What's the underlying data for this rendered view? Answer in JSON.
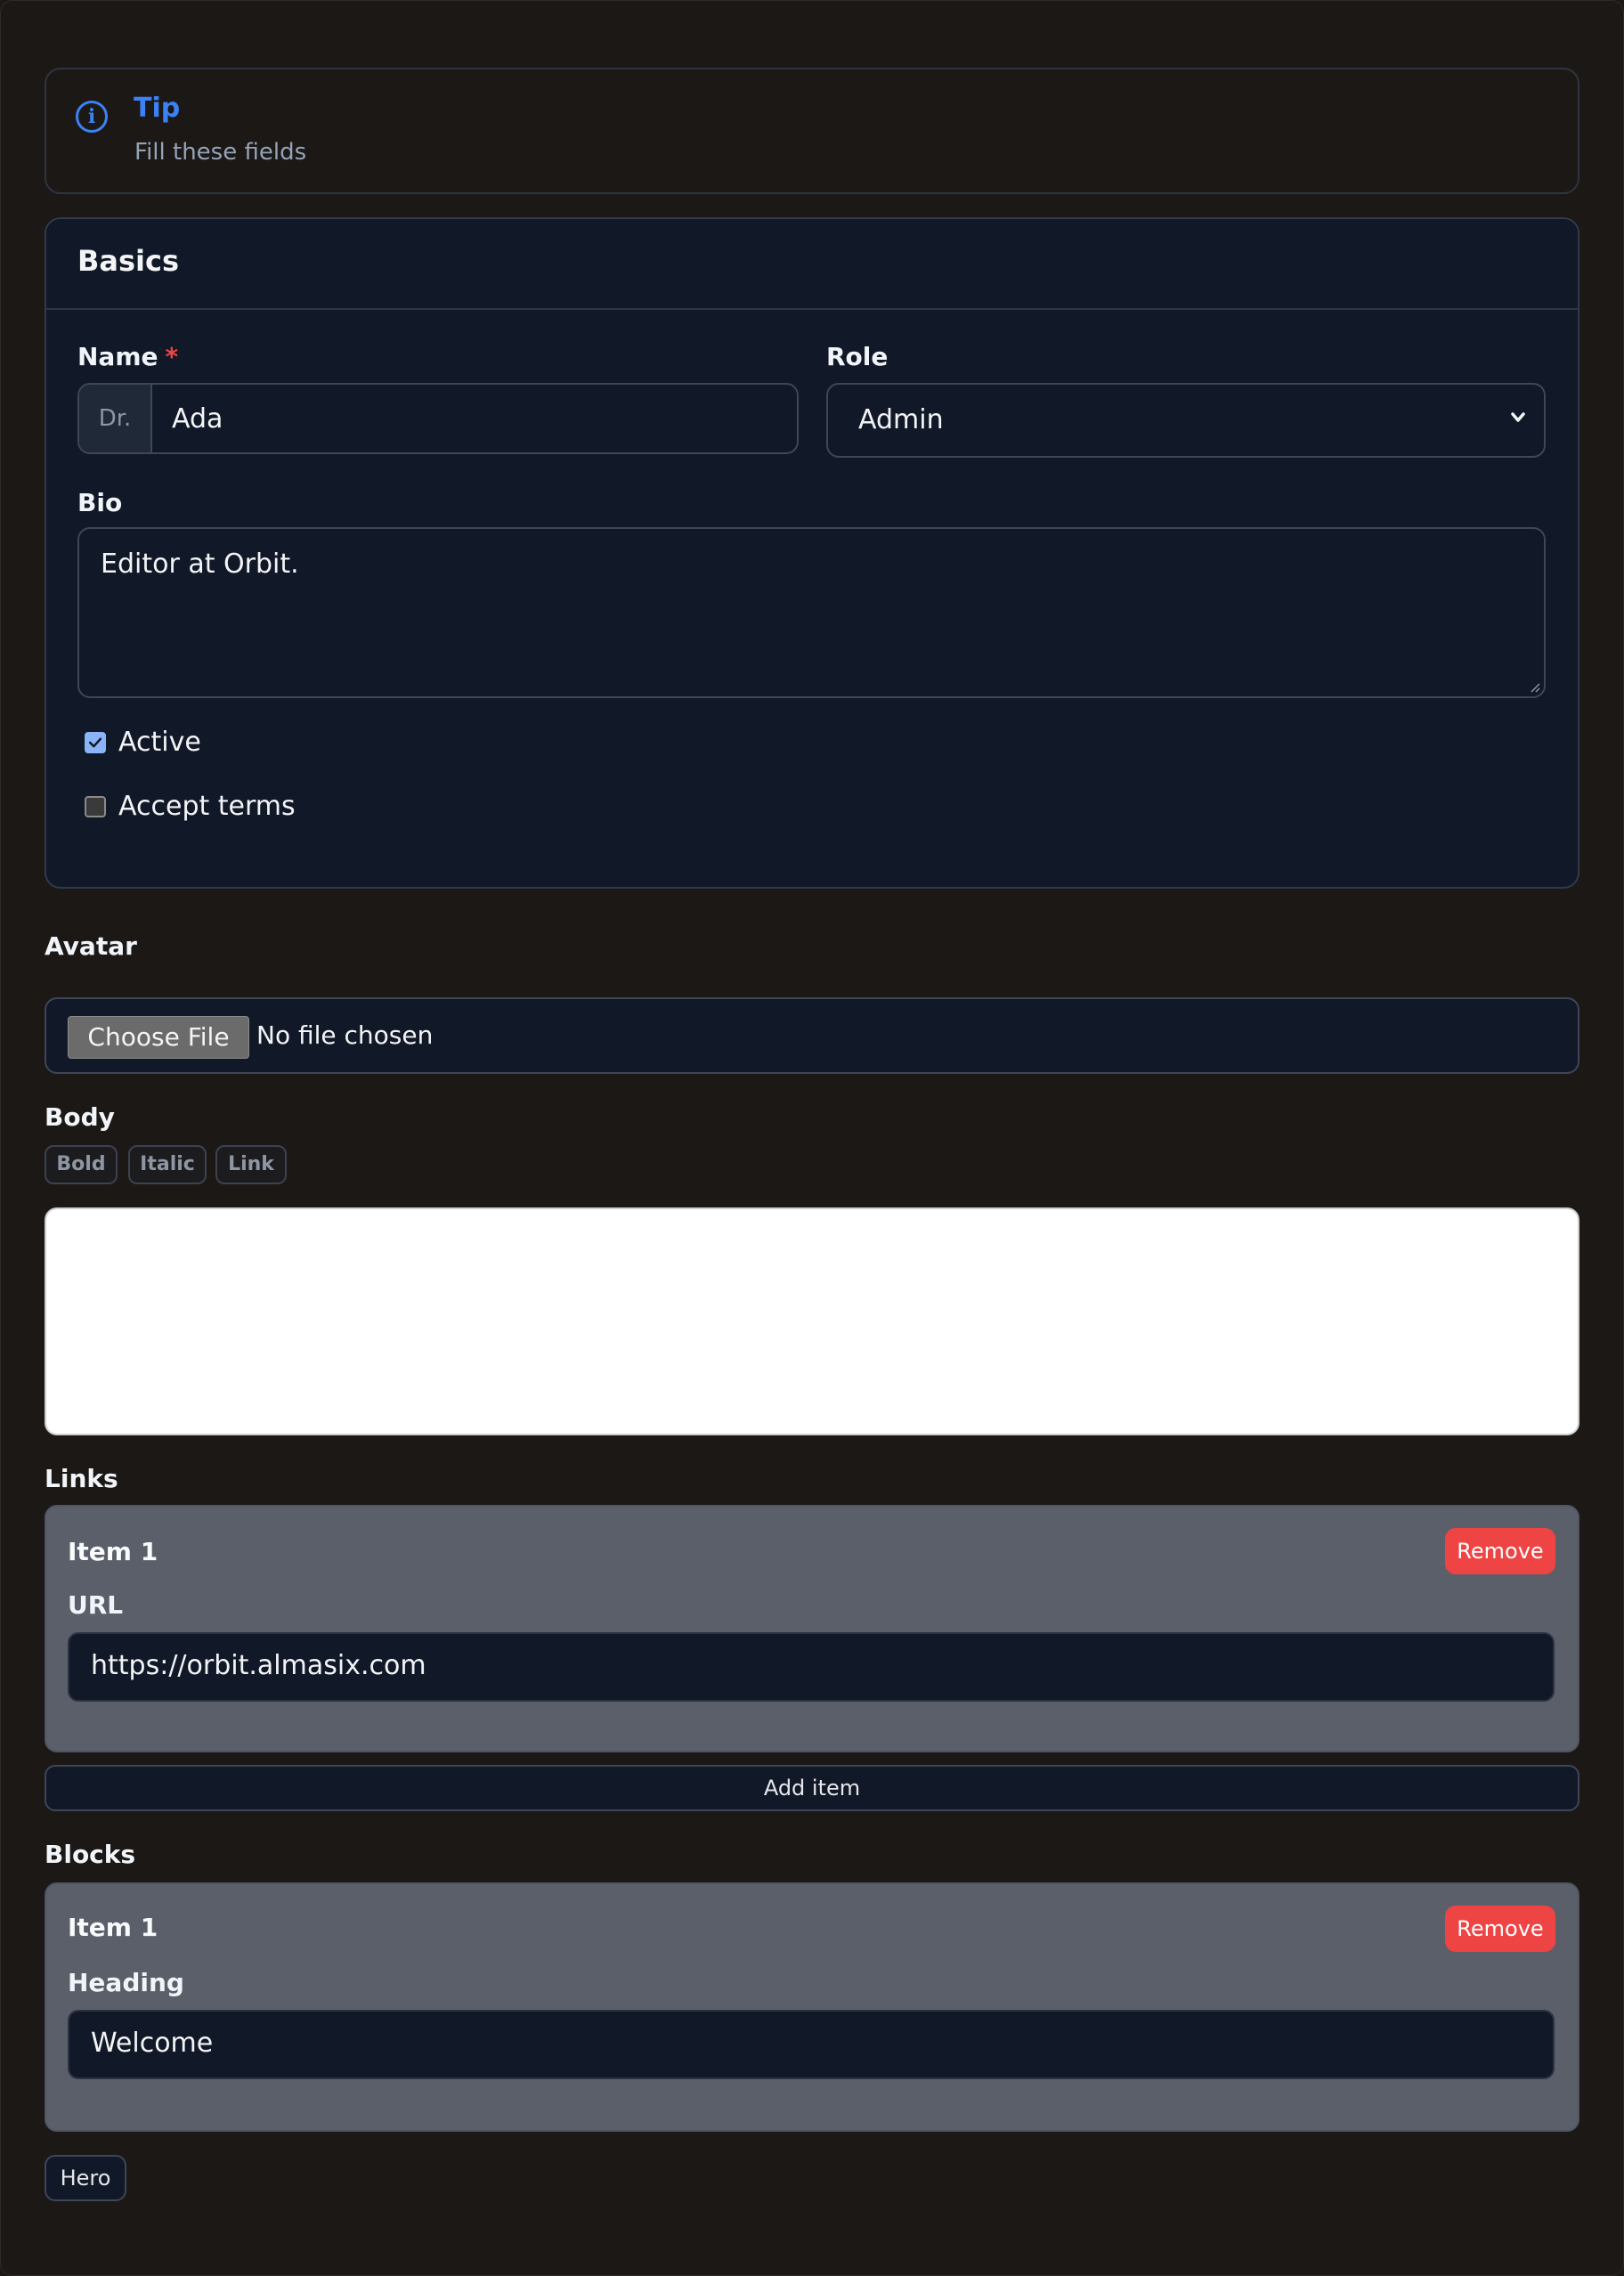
{
  "tip": {
    "title": "Tip",
    "text": "Fill these fields",
    "icon": "info-icon"
  },
  "basics": {
    "title": "Basics",
    "name": {
      "label": "Name",
      "required_mark": "*",
      "prefix": "Dr.",
      "value": "Ada"
    },
    "role": {
      "label": "Role",
      "value": "Admin"
    },
    "bio": {
      "label": "Bio",
      "value": "Editor at Orbit."
    },
    "active": {
      "label": "Active",
      "checked": true
    },
    "terms": {
      "label": "Accept terms",
      "checked": false
    }
  },
  "avatar": {
    "label": "Avatar",
    "button": "Choose File",
    "status": "No file chosen"
  },
  "body": {
    "label": "Body",
    "toolbar": [
      "Bold",
      "Italic",
      "Link"
    ]
  },
  "links": {
    "label": "Links",
    "items": [
      {
        "title": "Item 1",
        "remove": "Remove",
        "field_label": "URL",
        "value": "https://orbit.almasix.com"
      }
    ],
    "add": "Add item"
  },
  "blocks": {
    "label": "Blocks",
    "items": [
      {
        "title": "Item 1",
        "remove": "Remove",
        "field_label": "Heading",
        "value": "Welcome"
      }
    ],
    "add_hero": "Hero"
  },
  "colors": {
    "accent": "#3b82f6",
    "danger": "#ef4444",
    "card": "#111827",
    "page": "#1b1816"
  }
}
